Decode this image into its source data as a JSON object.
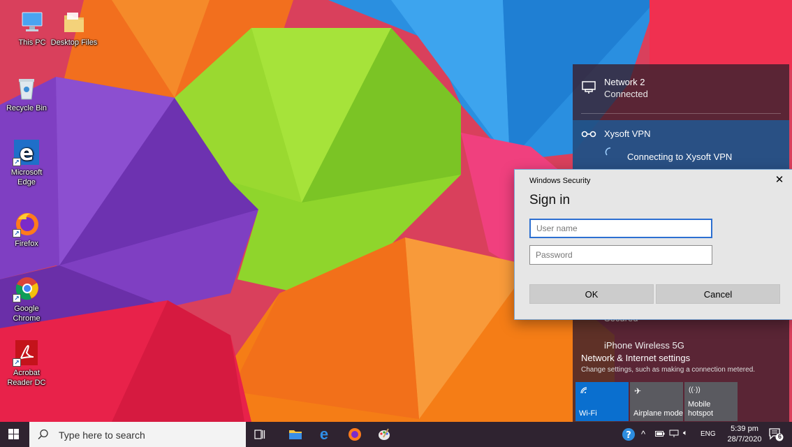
{
  "desktop": {
    "icons": [
      {
        "label": "This PC"
      },
      {
        "label": "Desktop Files"
      },
      {
        "label": "Recycle Bin"
      },
      {
        "label": "Microsoft Edge"
      },
      {
        "label": "Firefox"
      },
      {
        "label": "Google Chrome"
      },
      {
        "label": "Acrobat Reader DC"
      }
    ]
  },
  "network_flyout": {
    "network2": {
      "name": "Network 2",
      "status": "Connected"
    },
    "vpn": {
      "name": "Xysoft VPN",
      "status": "Connecting to Xysoft VPN"
    },
    "hidden_row_text": "Secured",
    "hidden_row_text2": "iPhone Wireless 5G",
    "settings_link": "Network & Internet settings",
    "settings_desc": "Change settings, such as making a connection metered.",
    "quick_actions": [
      {
        "label": "Wi-Fi",
        "active": true,
        "color": "#0a6fcf"
      },
      {
        "label": "Airplane mode",
        "active": false,
        "color": "#5a5a60"
      },
      {
        "label": "Mobile hotspot",
        "active": false,
        "color": "#5a5a60"
      }
    ]
  },
  "dialog": {
    "window_title": "Windows Security",
    "heading": "Sign in",
    "username_placeholder": "User name",
    "password_placeholder": "Password",
    "ok_label": "OK",
    "cancel_label": "Cancel"
  },
  "taskbar": {
    "search_placeholder": "Type here to search",
    "tray": {
      "language": "ENG",
      "time": "5:39 pm",
      "date": "28/7/2020",
      "notification_count": "6"
    }
  },
  "colors": {
    "accent": "#0a6fcf",
    "taskbar": "#2f2330",
    "dialog_bg": "#e6e6e6"
  }
}
